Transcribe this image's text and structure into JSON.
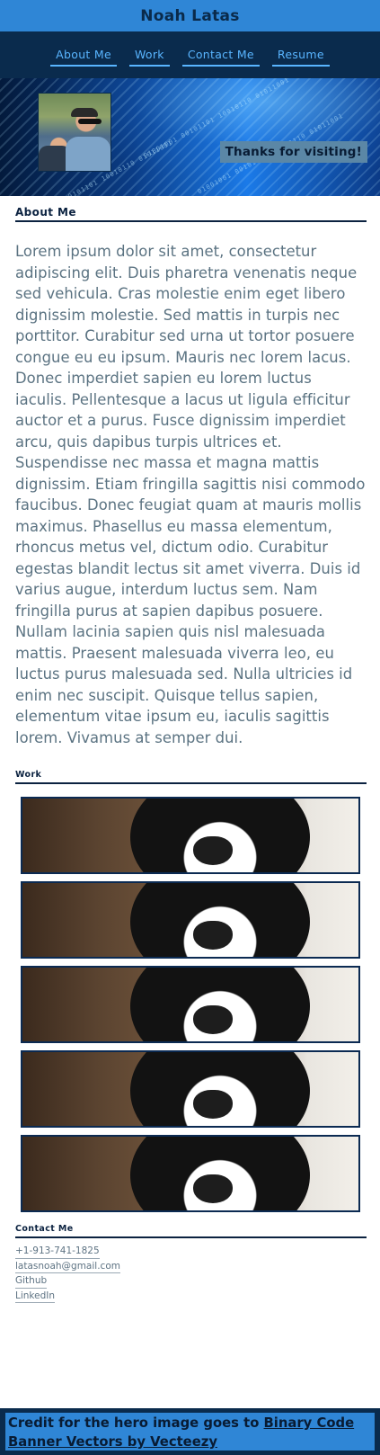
{
  "header": {
    "title": "Noah Latas"
  },
  "nav": {
    "items": [
      {
        "label": "About Me"
      },
      {
        "label": "Work"
      },
      {
        "label": "Contact Me"
      },
      {
        "label": "Resume"
      }
    ]
  },
  "hero": {
    "thanks": "Thanks for visiting!",
    "code_text": "01001001 00101101 10010110 01011001"
  },
  "about": {
    "title": "About Me",
    "text": "Lorem ipsum dolor sit amet, consectetur adipiscing elit. Duis pharetra venenatis neque sed vehicula. Cras molestie enim eget libero dignissim molestie. Sed mattis in turpis nec porttitor. Curabitur sed urna ut tortor posuere congue eu eu ipsum. Mauris nec lorem lacus. Donec imperdiet sapien eu lorem luctus iaculis. Pellentesque a lacus ut ligula efficitur auctor et a purus. Fusce dignissim imperdiet arcu, quis dapibus turpis ultrices et. Suspendisse nec massa et magna mattis dignissim. Etiam fringilla sagittis nisi commodo faucibus. Donec feugiat quam at mauris mollis maximus. Phasellus eu massa elementum, rhoncus metus vel, dictum odio. Curabitur egestas blandit lectus sit amet viverra. Duis id varius augue, interdum luctus sem. Nam fringilla purus at sapien dapibus posuere. Nullam lacinia sapien quis nisl malesuada mattis. Praesent malesuada viverra leo, eu luctus purus malesuada sed. Nulla ultricies id enim nec suscipit. Quisque tellus sapien, elementum vitae ipsum eu, iaculis sagittis lorem. Vivamus at semper dui."
  },
  "work": {
    "title": "Work",
    "count": 5
  },
  "contact": {
    "title": "Contact Me",
    "phone": "+1-913-741-1825",
    "email": "latasnoah@gmail.com",
    "github": "Github",
    "linkedin": "LinkedIn"
  },
  "footer": {
    "prefix": "Credit for the hero image goes to ",
    "link": "Binary Code Banner Vectors by Vecteezy"
  },
  "colors": {
    "header_bg": "#2f86d6",
    "nav_bg": "#0a2b4d",
    "nav_link": "#59b5ff",
    "text_body": "#5b7382",
    "title_dark": "#0b2240"
  }
}
